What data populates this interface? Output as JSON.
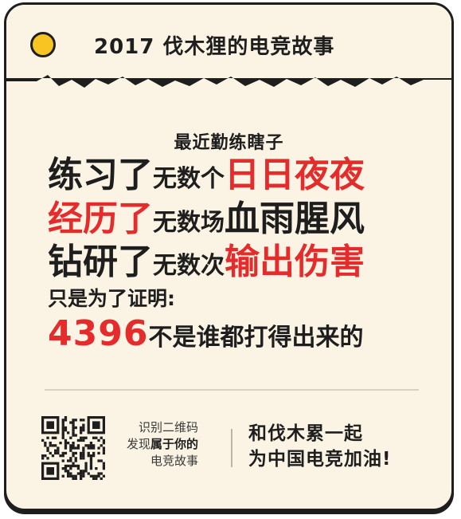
{
  "header": {
    "title": "2017 伐木狸的电竞故事",
    "dot_icon": "yellow-dot",
    "dot_color": "#F7C421"
  },
  "body": {
    "intro": "最近勤练瞎子",
    "line1": {
      "a": "练习了",
      "b": "无数个",
      "c": "日日夜夜"
    },
    "line2": {
      "a": "经历了",
      "b": "无数场",
      "c": "血雨腥风"
    },
    "line3": {
      "a": "钻研了",
      "b": "无数次",
      "c": "输出伤害"
    },
    "line4": "只是为了证明:",
    "line5": {
      "number": "4396",
      "rest": "不是谁都打得出来的"
    }
  },
  "footer": {
    "qr_icon": "qr-code",
    "qr_line1": "识别二维码",
    "qr_line2_prefix": "发现",
    "qr_line2_bold": "属于你的",
    "qr_line3": "电竞故事",
    "slogan_line1": "和伐木累一起",
    "slogan_line2": "为中国电竞加油!"
  },
  "colors": {
    "background": "#FBF4E4",
    "accent_red": "#E52C2C",
    "text": "#1E1E1E",
    "dot_yellow": "#F7C421"
  }
}
